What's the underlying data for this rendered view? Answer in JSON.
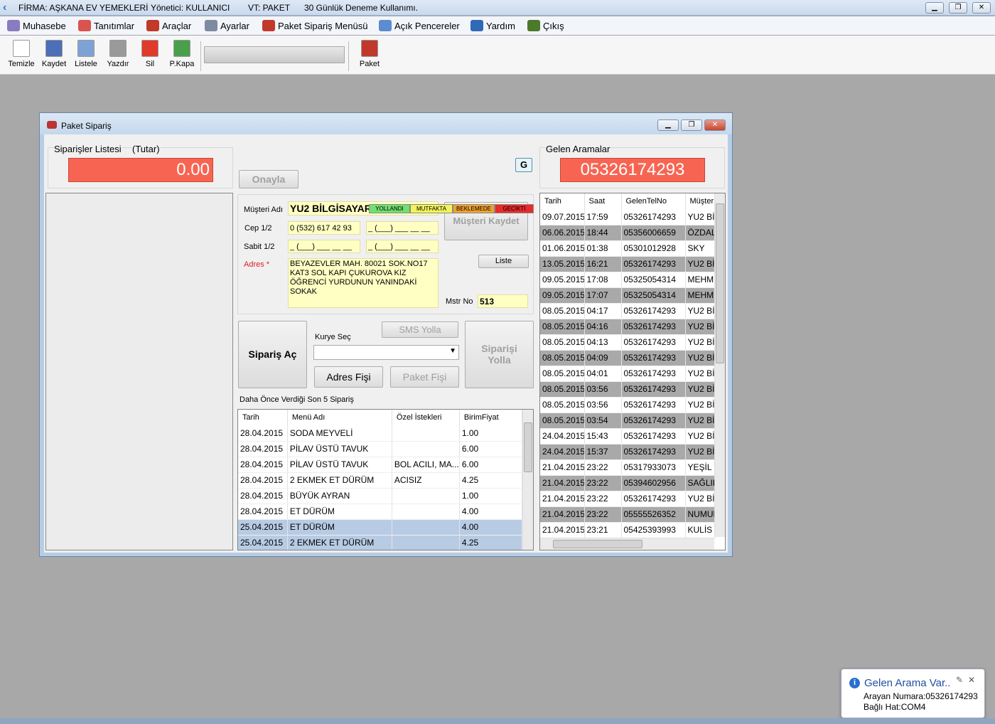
{
  "app": {
    "firm": "FİRMA: AŞKANA EV YEMEKLERİ",
    "manager": "Yönetici:  KULLANICI",
    "db": "VT: PAKET",
    "trial": "30 Günlük Deneme Kullanımı."
  },
  "menu": [
    "Muhasebe",
    "Tanıtımlar",
    "Araçlar",
    "Ayarlar",
    "Paket Sipariş Menüsü",
    "Açık Pencereler",
    "Yardım",
    "Çıkış"
  ],
  "menu_colors": [
    "#8a7bbf",
    "#d9534f",
    "#c0392b",
    "#7c8ba0",
    "#c0392b",
    "#5b8bd0",
    "#2e6ab5",
    "#4d7a2a"
  ],
  "toolbar": [
    "Temizle",
    "Kaydet",
    "Listele",
    "Yazdır",
    "Sil",
    "P.Kapa",
    "Paket"
  ],
  "toolbar_colors": [
    "#ffffff",
    "#4c6fb8",
    "#7da2d6",
    "#9a9a9a",
    "#e03b2a",
    "#4aa04a",
    "#c0392b"
  ],
  "window": {
    "title": "Paket Sipariş"
  },
  "orders": {
    "title": "Siparişler Listesi",
    "tutar_label": "(Tutar)",
    "total": "0.00"
  },
  "onayla": "Onayla",
  "g_button": "G",
  "status": [
    {
      "label": "YOLLANDI",
      "color": "#6fe06f"
    },
    {
      "label": "MUTFAKTA",
      "color": "#f2f25a"
    },
    {
      "label": "BEKLEMEDE",
      "color": "#f0a030"
    },
    {
      "label": "GECİKTİ",
      "color": "#e82a2a"
    }
  ],
  "customer": {
    "name_label": "Müşteri Adı",
    "name": "YU2 BİLGİSAYAR",
    "cep_label": "Cep  1/2",
    "cep1": "0 (532) 617 42 93",
    "cep2": "_ (___) ___ __ __",
    "sabit_label": "Sabit 1/2",
    "sabit1": "_ (___) ___ __ __",
    "sabit2": "_ (___) ___ __ __",
    "adres_label": "Adres *",
    "adres": "BEYAZEVLER MAH. 80021 SOK.NO17 KAT3 SOL KAPI ÇUKUROVA KIZ ÖĞRENCİ YURDUNUN YANINDAKİ SOKAK",
    "save_button": "Müşteri Kaydet",
    "liste_button": "Liste",
    "mstr_label": "Mstr No",
    "mstr": "513"
  },
  "order_actions": {
    "siparis_ac": "Sipariş Aç",
    "kurye_label": "Kurye Seç",
    "sms": "SMS Yolla",
    "adres_fisi": "Adres Fişi",
    "paket_fisi": "Paket Fişi",
    "siparisi_yolla": "Siparişi Yolla"
  },
  "history": {
    "title": "Daha Önce Verdiği Son 5 Sipariş",
    "columns": [
      "Tarih",
      "Menü Adı",
      "Özel İstekleri",
      "BirimFiyat"
    ],
    "rows": [
      [
        "28.04.2015",
        "SODA MEYVELİ",
        "",
        "1.00"
      ],
      [
        "28.04.2015",
        "PİLAV ÜSTÜ TAVUK",
        "",
        "6.00"
      ],
      [
        "28.04.2015",
        "PİLAV ÜSTÜ TAVUK",
        "BOL ACILI, MA...",
        "6.00"
      ],
      [
        "28.04.2015",
        "2 EKMEK ET DÜRÜM",
        "ACISIZ",
        "4.25"
      ],
      [
        "28.04.2015",
        "BÜYÜK AYRAN",
        "",
        "1.00"
      ],
      [
        "28.04.2015",
        "ET DÜRÜM",
        "",
        "4.00"
      ],
      [
        "25.04.2015",
        "ET DÜRÜM",
        "",
        "4.00"
      ],
      [
        "25.04.2015",
        "2 EKMEK ET DÜRÜM",
        "",
        "4.25"
      ]
    ],
    "selected": [
      6,
      7
    ]
  },
  "calls": {
    "title": "Gelen Aramalar",
    "current": "05326174293",
    "columns": [
      "Tarih",
      "Saat",
      "GelenTelNo",
      "Müşter"
    ],
    "rows": [
      [
        "09.07.2015",
        "17:59",
        "05326174293",
        "YU2 Bİ"
      ],
      [
        "06.06.2015",
        "18:44",
        "05356006659",
        "ÖZDAL"
      ],
      [
        "01.06.2015",
        "01:38",
        "05301012928",
        "SKY"
      ],
      [
        "13.05.2015",
        "16:21",
        "05326174293",
        "YU2 Bİ"
      ],
      [
        "09.05.2015",
        "17:08",
        "05325054314",
        "MEHME"
      ],
      [
        "09.05.2015",
        "17:07",
        "05325054314",
        "MEHME"
      ],
      [
        "08.05.2015",
        "04:17",
        "05326174293",
        "YU2 Bİ"
      ],
      [
        "08.05.2015",
        "04:16",
        "05326174293",
        "YU2 Bİ"
      ],
      [
        "08.05.2015",
        "04:13",
        "05326174293",
        "YU2 Bİ"
      ],
      [
        "08.05.2015",
        "04:09",
        "05326174293",
        "YU2 Bİ"
      ],
      [
        "08.05.2015",
        "04:01",
        "05326174293",
        "YU2 Bİ"
      ],
      [
        "08.05.2015",
        "03:56",
        "05326174293",
        "YU2 Bİ"
      ],
      [
        "08.05.2015",
        "03:56",
        "05326174293",
        "YU2 Bİ"
      ],
      [
        "08.05.2015",
        "03:54",
        "05326174293",
        "YU2 Bİ"
      ],
      [
        "24.04.2015",
        "15:43",
        "05326174293",
        "YU2 Bİ"
      ],
      [
        "24.04.2015",
        "15:37",
        "05326174293",
        "YU2 Bİ"
      ],
      [
        "21.04.2015",
        "23:22",
        "05317933073",
        "YEŞİL Y"
      ],
      [
        "21.04.2015",
        "23:22",
        "05394602956",
        "SAĞLIK"
      ],
      [
        "21.04.2015",
        "23:22",
        "05326174293",
        "YU2 Bİ"
      ],
      [
        "21.04.2015",
        "23:22",
        "05555526352",
        "NUMUN"
      ],
      [
        "21.04.2015",
        "23:21",
        "05425393993",
        "KULİS I"
      ]
    ]
  },
  "toast": {
    "title": "Gelen Arama Var..",
    "line1": "Arayan Numara:05326174293",
    "line2": "Bağlı Hat:COM4"
  }
}
